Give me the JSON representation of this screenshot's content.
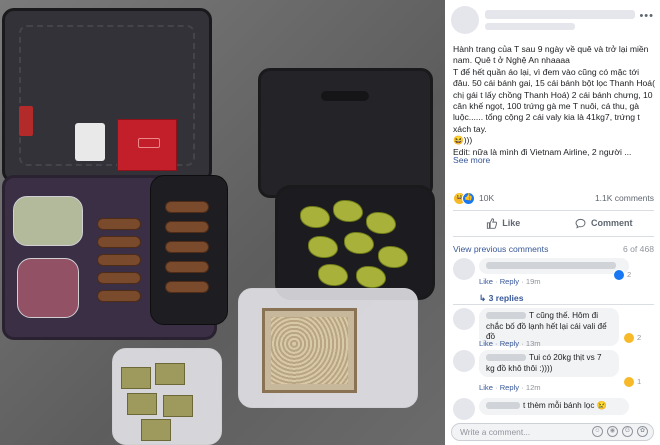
{
  "post": {
    "caption": "Hành trang của T sau 9 ngày về quê và trở lại miền nam. Quê t ở Nghệ An nhaaaa\nT để hết quần áo lại, vì đem vào cũng có mặc tới đâu. 50 cái bánh gai, 15 cái bánh bột lọc Thanh Hoá( chị gái t lấy chồng Thanh Hoá) 2 cái bánh chưng, 10 cân khế ngọt, 100 trứng gà me T nuôi, cá thu, gà luộc...... tổng cộng 2 cái valy kia là 41kg7, trứng t xách tay.\n😆)))\nEdit: nữa là mình đi Vietnam Airline, 2 người ...",
    "see_more": "See more",
    "more_options": "•••"
  },
  "reactions": {
    "count": "10K",
    "comments_count": "1.1K comments",
    "haha_glyph": "😆",
    "like_glyph": "👍"
  },
  "actions": {
    "like": "Like",
    "comment": "Comment"
  },
  "comments_header": {
    "view_previous": "View previous comments",
    "page_count": "6 of 468"
  },
  "comments": [
    {
      "text": "",
      "like": "Like",
      "reply": "Reply",
      "time": "19m",
      "reaction_count": "2",
      "replies": "3 replies"
    },
    {
      "text": "T cũng thế. Hôm đi chắc bố đồ lạnh hết lại cái vali để đồ",
      "like": "Like",
      "reply": "Reply",
      "time": "13m",
      "reaction_count": "2"
    },
    {
      "text": "Tui có 20kg thịt vs 7 kg đồ khô thôi :))))",
      "like": "Like",
      "reply": "Reply",
      "time": "12m",
      "reaction_count": "1"
    },
    {
      "text": "t thèm mỗi bánh lọc 😢",
      "like": "",
      "reply": "",
      "time": ""
    }
  ],
  "write_box": {
    "placeholder": "Write a comment..."
  },
  "colors": {
    "link": "#385898",
    "like_blue": "#1877f2",
    "haha_yellow": "#f7b928"
  },
  "icons": [
    "like-icon",
    "comment-icon",
    "haha-reaction-icon",
    "like-reaction-icon",
    "emoji-icon",
    "camera-icon",
    "gif-icon",
    "sticker-icon"
  ]
}
